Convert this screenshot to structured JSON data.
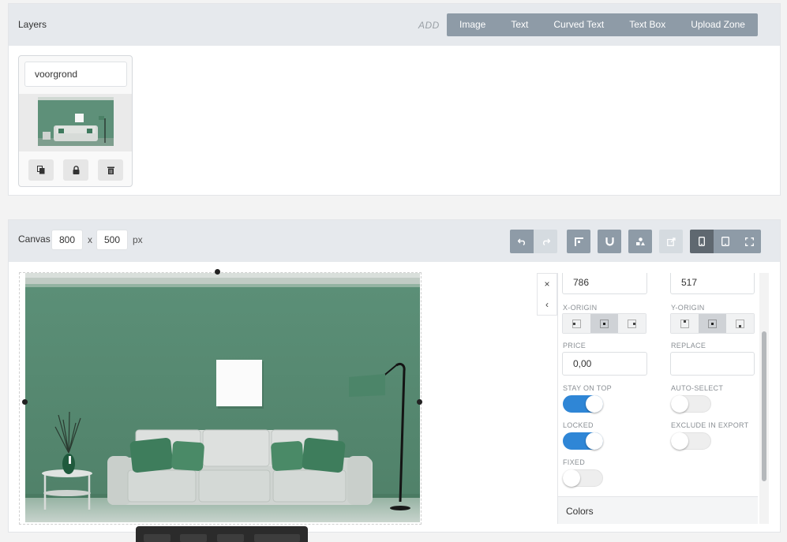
{
  "layers": {
    "title": "Layers",
    "add_label": "ADD",
    "add_buttons": [
      "Image",
      "Text",
      "Curved Text",
      "Text Box",
      "Upload Zone"
    ],
    "items": [
      {
        "name": "voorgrond",
        "actions": [
          "duplicate-icon",
          "lock-icon",
          "trash-icon"
        ]
      }
    ]
  },
  "canvas": {
    "title": "Canvas",
    "width": "800",
    "times": "x",
    "height": "500",
    "unit": "px",
    "toolbar": [
      "undo-icon",
      "redo-icon",
      "align-icon",
      "magnet-icon",
      "group-icon",
      "resize-icon",
      "mobile-icon",
      "tablet-icon",
      "fullscreen-icon"
    ]
  },
  "properties": {
    "close_glyph": "×",
    "collapse_glyph": "‹",
    "x_value": "786",
    "y_value": "517",
    "x_origin_label": "X-ORIGIN",
    "y_origin_label": "Y-ORIGIN",
    "price_label": "PRICE",
    "price_value": "0,00",
    "replace_label": "REPLACE",
    "replace_value": "",
    "stay_on_top_label": "STAY ON TOP",
    "stay_on_top": true,
    "auto_select_label": "AUTO-SELECT",
    "auto_select": false,
    "locked_label": "LOCKED",
    "locked": true,
    "exclude_label": "EXCLUDE IN EXPORT",
    "exclude": false,
    "fixed_label": "FIXED",
    "fixed": false,
    "colors_label": "Colors"
  },
  "colors": {
    "toolbar": "#8e9ba7",
    "toggle_on": "#2f86d6",
    "wall": "#5e9079"
  }
}
